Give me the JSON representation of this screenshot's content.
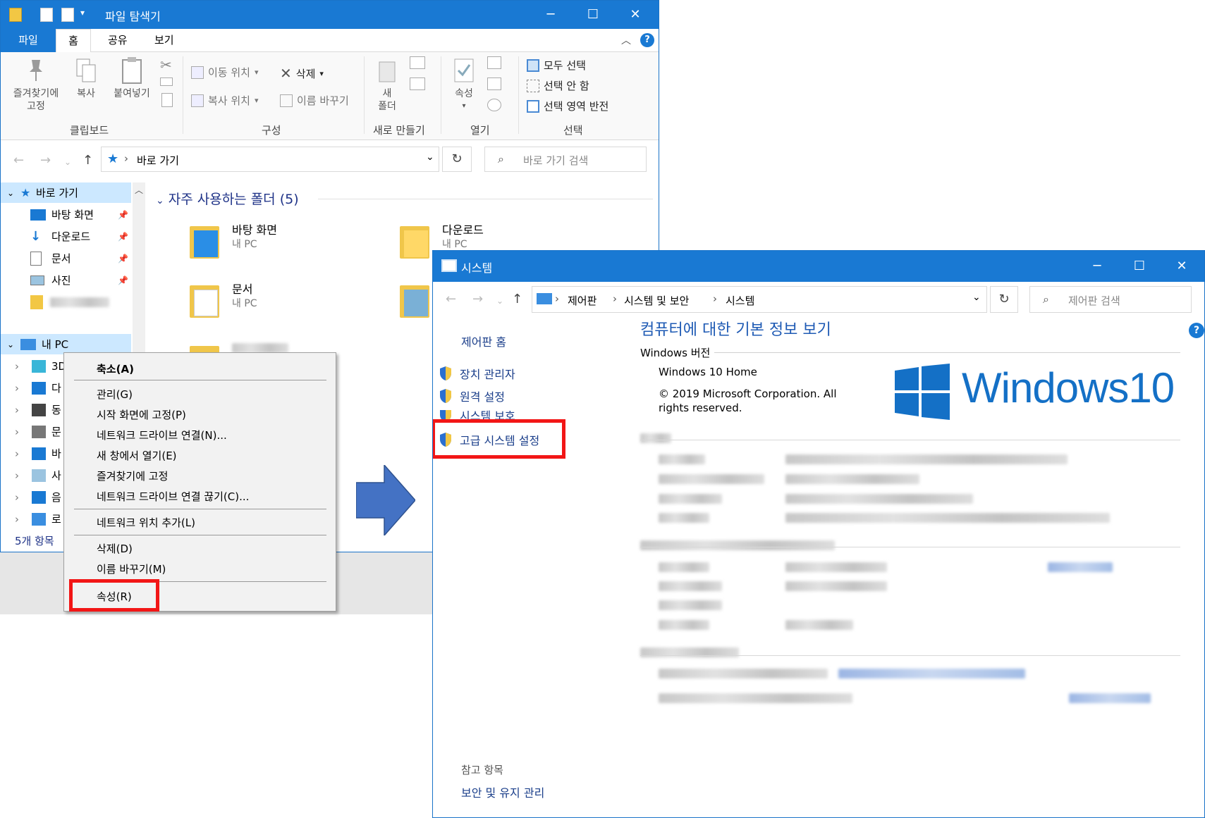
{
  "explorer": {
    "title": "파일 탐색기",
    "tabs": [
      "파일",
      "홈",
      "공유",
      "보기"
    ],
    "ribbon": {
      "pin_label_1": "즐겨찾기에",
      "pin_label_2": "고정",
      "copy": "복사",
      "paste": "붙여넣기",
      "move_to": "이동 위치",
      "copy_to": "복사 위치",
      "delete": "삭제",
      "rename": "이름 바꾸기",
      "new_folder_1": "새",
      "new_folder_2": "폴더",
      "properties": "속성",
      "select_all": "모두 선택",
      "select_none": "선택 안 함",
      "invert_selection": "선택 영역 반전",
      "groups": {
        "clipboard": "클립보드",
        "organize": "구성",
        "new": "새로 만들기",
        "open": "열기",
        "select": "선택"
      }
    },
    "address": {
      "path": "바로 가기",
      "search_placeholder": "바로 가기 검색"
    },
    "nav": {
      "quick_access": "바로 가기",
      "desktop": "바탕 화면",
      "downloads": "다운로드",
      "documents": "문서",
      "pictures": "사진",
      "this_pc": "내 PC",
      "pc_children": [
        "3D",
        "다",
        "동",
        "문",
        "바",
        "사",
        "음",
        "로"
      ]
    },
    "content": {
      "section_title": "자주 사용하는 폴더 (5)",
      "folders": [
        {
          "name": "바탕 화면",
          "sub": "내 PC"
        },
        {
          "name": "다운로드",
          "sub": "내 PC"
        },
        {
          "name": "문서",
          "sub": "내 PC"
        }
      ]
    },
    "status": "5개 항목"
  },
  "context_menu": {
    "items": [
      "축소(A)",
      "관리(G)",
      "시작 화면에 고정(P)",
      "네트워크 드라이브 연결(N)...",
      "새 창에서 열기(E)",
      "즐겨찾기에 고정",
      "네트워크 드라이브 연결 끊기(C)...",
      "네트워크 위치 추가(L)",
      "삭제(D)",
      "이름 바꾸기(M)",
      "속성(R)"
    ]
  },
  "system": {
    "title": "시스템",
    "breadcrumb": [
      "제어판",
      "시스템 및 보안",
      "시스템"
    ],
    "search_placeholder": "제어판 검색",
    "side": {
      "home": "제어판 홈",
      "device_manager": "장치 관리자",
      "remote": "원격 설정",
      "protection": "시스템 보호",
      "advanced": "고급 시스템 설정",
      "see_also": "참고 항목",
      "security": "보안 및 유지 관리"
    },
    "heading": "컴퓨터에 대한 기본 정보 보기",
    "windows_edition_label": "Windows 버전",
    "edition": "Windows 10 Home",
    "copyright": "© 2019 Microsoft Corporation. All rights reserved.",
    "logo_text": "Windows10"
  },
  "colors": {
    "accent": "#1979d3",
    "highlight": "#f21616",
    "link": "#1a3e8a"
  }
}
